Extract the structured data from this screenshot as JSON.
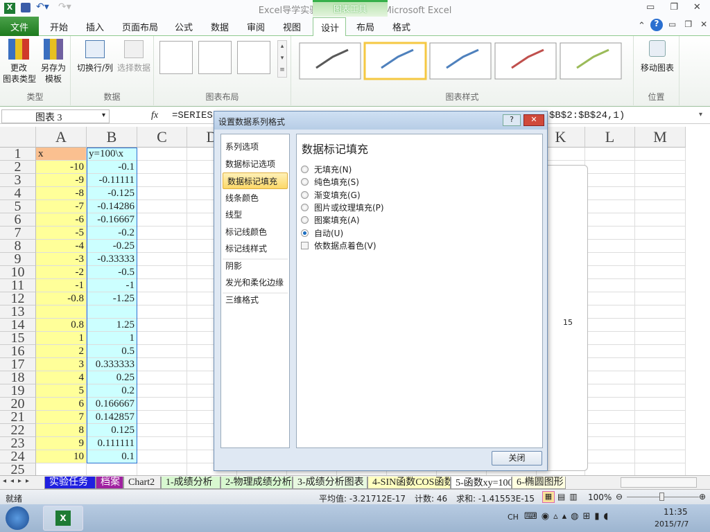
{
  "window": {
    "title": "Excel导学实验12-图表应用1  -  Microsoft Excel",
    "context_group": "图表工具"
  },
  "tabs": [
    "文件",
    "开始",
    "插入",
    "页面布局",
    "公式",
    "数据",
    "审阅",
    "视图",
    "设计",
    "布局",
    "格式"
  ],
  "ribbon": {
    "groups": [
      {
        "label": "类型",
        "buttons": [
          "更改\n图表类型",
          "另存为\n模板"
        ]
      },
      {
        "label": "数据",
        "buttons": [
          "切换行/列",
          "选择数据"
        ]
      },
      {
        "label": "图表布局"
      },
      {
        "label": "图表样式",
        "style_colors": [
          "#595959",
          "#4f81bd",
          "#4f81bd",
          "#c0504d",
          "#9bbb59"
        ]
      },
      {
        "label": "位置",
        "buttons": [
          "移动图表"
        ]
      }
    ]
  },
  "formula_bar": {
    "name_box": "图表 3",
    "fx": "fx",
    "formula_start": "=SERIES(",
    "formula_end": "$B$2:$B$24,1)"
  },
  "columns": [
    "A",
    "B",
    "C",
    "D",
    "E",
    "F",
    "G",
    "H",
    "I",
    "J",
    "K",
    "L",
    "M"
  ],
  "rows": [
    [
      "x",
      "y=100\\x"
    ],
    [
      "-10",
      "-0.1"
    ],
    [
      "-9",
      "-0.11111"
    ],
    [
      "-8",
      "-0.125"
    ],
    [
      "-7",
      "-0.14286"
    ],
    [
      "-6",
      "-0.16667"
    ],
    [
      "-5",
      "-0.2"
    ],
    [
      "-4",
      "-0.25"
    ],
    [
      "-3",
      "-0.33333"
    ],
    [
      "-2",
      "-0.5"
    ],
    [
      "-1",
      "-1"
    ],
    [
      "-0.8",
      "-1.25"
    ],
    [
      "",
      ""
    ],
    [
      "0.8",
      "1.25"
    ],
    [
      "1",
      "1"
    ],
    [
      "2",
      "0.5"
    ],
    [
      "3",
      "0.333333"
    ],
    [
      "4",
      "0.25"
    ],
    [
      "5",
      "0.2"
    ],
    [
      "6",
      "0.166667"
    ],
    [
      "7",
      "0.142857"
    ],
    [
      "8",
      "0.125"
    ],
    [
      "9",
      "0.111111"
    ],
    [
      "10",
      "0.1"
    ],
    [
      "",
      ""
    ]
  ],
  "chart": {
    "axis_label": "15"
  },
  "dialog": {
    "title": "设置数据系列格式",
    "nav": [
      "系列选项",
      "数据标记选项",
      "数据标记填充",
      "线条颜色",
      "线型",
      "标记线颜色",
      "标记线样式",
      "阴影",
      "发光和柔化边缘",
      "三维格式"
    ],
    "selected_nav": "数据标记填充",
    "heading": "数据标记填充",
    "options": [
      "无填充(N)",
      "纯色填充(S)",
      "渐变填充(G)",
      "图片或纹理填充(P)",
      "图案填充(A)",
      "自动(U)"
    ],
    "selected_option": "自动(U)",
    "checkbox": "依数据点着色(V)",
    "close": "关闭"
  },
  "sheet_tabs": [
    "实验任务",
    "档案",
    "Chart2",
    "1-成绩分析",
    "2-物理成绩分析",
    "3-成绩分析图表",
    "4-SIN函数COS函数",
    "5-函数xy=100",
    "6-椭圆图形"
  ],
  "status": {
    "ready": "就绪",
    "average": "平均值: -3.21712E-17",
    "count": "计数: 46",
    "sum": "求和: -1.41553E-15",
    "zoom": "100%"
  },
  "taskbar": {
    "lang": "CH",
    "time": "11:35",
    "date": "2015/7/7"
  }
}
